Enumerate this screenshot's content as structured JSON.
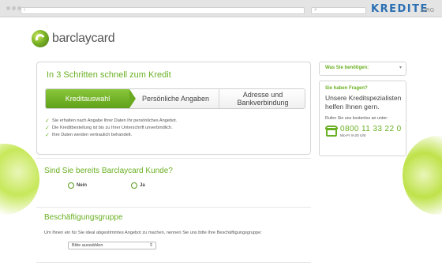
{
  "browser": {
    "brand": "KREDITE",
    "brand_tld": ".ORG"
  },
  "logo": {
    "text": "barclaycard"
  },
  "main": {
    "title": "In 3 Schritten schnell zum Kredit",
    "steps": [
      {
        "label": "Kreditauswahl"
      },
      {
        "label": "Persönliche Angaben"
      },
      {
        "label": "Adresse und Bankverbindung"
      }
    ],
    "bullets": [
      "Sie erhalten nach Angabe Ihrer Daten Ihr persönliches Angebot.",
      "Die Kreditbestellung ist bis zu Ihrer Unterschrift unverbindlich.",
      "Ihre Daten werden vertraulich behandelt."
    ]
  },
  "customer_question": {
    "title": "Sind Sie bereits Barclaycard Kunde?",
    "options": [
      {
        "label": "Nein"
      },
      {
        "label": "Ja"
      }
    ]
  },
  "employment": {
    "title": "Beschäftigungsgruppe",
    "description": "Um Ihnen ein für Sie ideal abgestimmtes Angebot zu machen, nennen Sie uns bitte Ihre Beschäftigungsgruppe:",
    "select_value": "Bitte auswählen"
  },
  "sidebar": {
    "needs_label": "Was Sie benötigen:",
    "help_heading": "Sie haben Fragen?",
    "help_text": "Unsere Kreditspezialisten helfen Ihnen gern.",
    "call_text": "Rufen Sie uns kostenlos an unter:",
    "phone": "0800 11 33 22 0",
    "hours": "Mo-Fr 8-20 Uhr"
  },
  "colors": {
    "accent": "#6ab023",
    "brand_blue": "#2b6fb3"
  }
}
